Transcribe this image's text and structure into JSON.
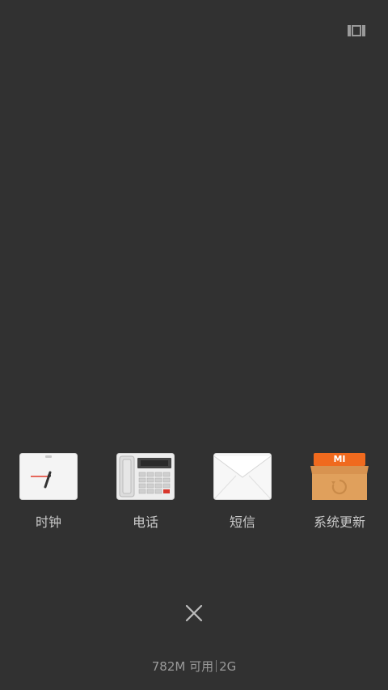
{
  "recent_apps": [
    {
      "label": "时钟",
      "icon": "clock-icon"
    },
    {
      "label": "电话",
      "icon": "phone-icon"
    },
    {
      "label": "短信",
      "icon": "envelope-icon"
    },
    {
      "label": "系统更新",
      "icon": "update-box-icon",
      "brand_text": "MI"
    }
  ],
  "close_icon": "close-icon",
  "view_toggle_icon": "grid-view-icon",
  "memory": {
    "available": "782M 可用",
    "total": "2G"
  },
  "colors": {
    "background": "#313131",
    "label_text": "#c9c9c9",
    "update_orange": "#f06a1e",
    "box_tan": "#e0a05c"
  }
}
